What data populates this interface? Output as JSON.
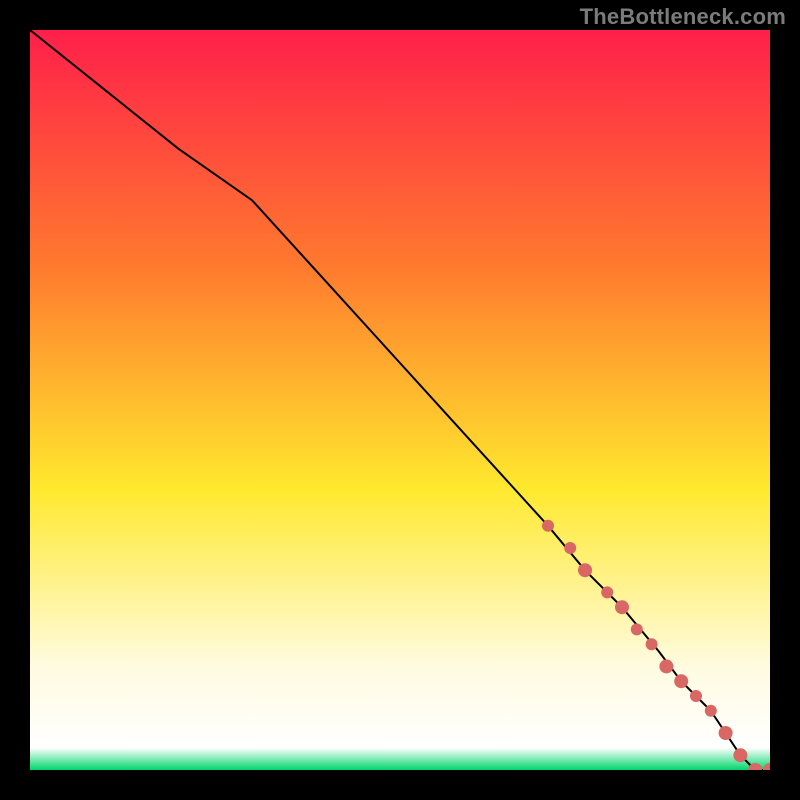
{
  "watermark": "TheBottleneck.com",
  "colors": {
    "bg_black": "#000000",
    "grad_top": "#ff1f4a",
    "grad_mid1": "#ff7a2e",
    "grad_mid2": "#ffe92e",
    "grad_pale": "#fffbe0",
    "grad_green": "#00d66a",
    "line": "#000000",
    "marker": "#d96763"
  },
  "chart_data": {
    "type": "line",
    "title": "",
    "xlabel": "",
    "ylabel": "",
    "xlim": [
      0,
      100
    ],
    "ylim": [
      0,
      100
    ],
    "grid": false,
    "line": {
      "name": "bottleneck-curve",
      "x": [
        0,
        10,
        20,
        30,
        40,
        50,
        60,
        70,
        75,
        80,
        85,
        88,
        90,
        92,
        94,
        96,
        98,
        100
      ],
      "y": [
        100,
        92,
        84,
        77,
        66,
        55,
        44,
        33,
        27,
        22,
        16,
        12,
        10,
        8,
        5,
        2,
        0,
        0
      ]
    },
    "markers": {
      "name": "highlight-points",
      "x": [
        70,
        73,
        75,
        78,
        80,
        82,
        84,
        86,
        88,
        90,
        92,
        94,
        96,
        98,
        100
      ],
      "y": [
        33,
        30,
        27,
        24,
        22,
        19,
        17,
        14,
        12,
        10,
        8,
        5,
        2,
        0,
        0
      ],
      "r": [
        6,
        6,
        7,
        6,
        7,
        6,
        6,
        7,
        7,
        6,
        6,
        7,
        7,
        7,
        7
      ]
    }
  }
}
